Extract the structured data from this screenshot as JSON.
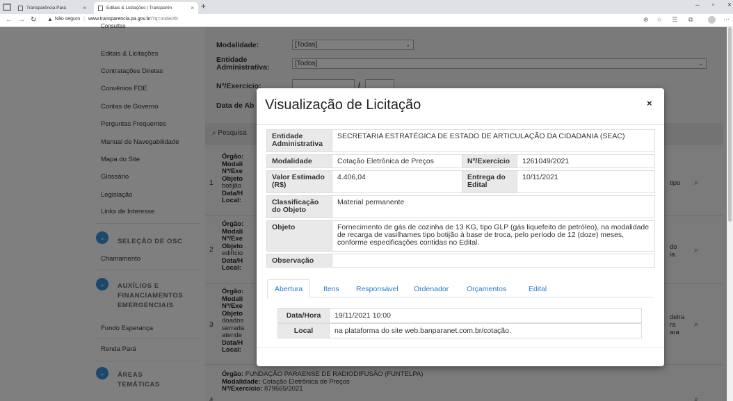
{
  "browser": {
    "tabs": [
      {
        "title": "Transparência Pará",
        "active": false
      },
      {
        "title": "Editais & Licitações | Transparên",
        "active": true
      }
    ],
    "security_label": "Não seguro",
    "url_host": "www.transparencia.pa.gov.br",
    "url_path": "/?q=node/45"
  },
  "sidebar": {
    "items_top": [
      "Consultas",
      "Editais & Licitações",
      "Contratações Diretas",
      "Convênios FDE",
      "Contas de Governo",
      "Perguntas Frequentes",
      "Manual de Navegabilidade",
      "Mapa do Site",
      "Glossário",
      "Legislação",
      "Links de Interesse"
    ],
    "section_osc": {
      "title": "SELEÇÃO DE OSC",
      "items": [
        "Chamamento"
      ]
    },
    "section_aux": {
      "title_lines": [
        "AUXÍLIOS E",
        "FINANCIAMENTOS",
        "EMERGENCIAIS"
      ],
      "items": [
        "Fundo Esperança",
        "Renda Pará"
      ]
    },
    "section_areas": {
      "title_lines": [
        "ÁREAS",
        "TEMÁTICAS"
      ]
    }
  },
  "filters": {
    "modalidade_label": "Modalidade:",
    "modalidade_value": "[Todas]",
    "entidade_label_1": "Entidade",
    "entidade_label_2": "Administrativa:",
    "entidade_value": "[Todos]",
    "exercicio_label": "Nº/Exercício:",
    "exercicio_sep": "/",
    "data_label": "Data de Ab"
  },
  "search": {
    "label": "Pesquisa"
  },
  "background_rows": [
    {
      "num": "1",
      "lines": [
        "Órgão:",
        "Modali",
        "Nº/Exe",
        "Objeto",
        "botijão",
        "Data/H",
        "Local:"
      ],
      "side": "tipo"
    },
    {
      "num": "2",
      "lines": [
        "Órgão:",
        "Modali",
        "Nº/Exe",
        "Objeto",
        "edifício",
        "Data/H",
        "Local:"
      ],
      "side": "do\nia."
    },
    {
      "num": "3",
      "lines": [
        "Órgão:",
        "Modali",
        "Nº/Exe",
        "Objeto",
        "doados",
        "serrada",
        "atende",
        "Data/H",
        "Local:"
      ],
      "side": "deira\nra\nara"
    },
    {
      "num": "4",
      "orgao_label": "Órgão:",
      "orgao_value": "FUNDAÇÃO PARAENSE DE RADIODIFUSÃO (FUNTELPA)",
      "modalidade_label": "Modalidade:",
      "modalidade_value": "Cotação Eletrônica de Preços",
      "exercicio_label": "Nº/Exercício:",
      "exercicio_value": "879665/2021"
    }
  ],
  "modal": {
    "title": "Visualização de Licitação",
    "close": "×",
    "fields": {
      "entidade_label": "Entidade Administrativa",
      "entidade_value": "SECRETARIA ESTRATÉGICA DE ESTADO DE ARTICULAÇÃO DA CIDADANIA (SEAC)",
      "modalidade_label": "Modalidade",
      "modalidade_value": "Cotação Eletrônica de Preços",
      "exercicio_label": "Nº/Exercício",
      "exercicio_value": "1261049/2021",
      "valor_label": "Valor Estimado (R$)",
      "valor_value": "4.406,04",
      "entrega_label": "Entrega do Edital",
      "entrega_value": "10/11/2021",
      "classificacao_label": "Classificação do Objeto",
      "classificacao_value": "Material permanente",
      "objeto_label": "Objeto",
      "objeto_value": "Fornecimento de gás de cozinha de 13 KG, tipo GLP (gás liquefeito de petróleo), na modalidade de recarga de vasilhames tipo botijão à base de troca, pelo período de 12 (doze) meses, conforme especificações contidas no Edital.",
      "observacao_label": "Observação",
      "observacao_value": ""
    },
    "tabs": [
      "Abertura",
      "Itens",
      "Responsável",
      "Ordenador",
      "Orçamentos",
      "Edital"
    ],
    "active_tab": "Abertura",
    "abertura": {
      "data_label": "Data/Hora",
      "data_value": "19/11/2021 10:00",
      "local_label": "Local",
      "local_value": "na plataforma do site web.banparanet.com.br/cotação."
    }
  },
  "colors": {
    "accent": "#2a7ac6",
    "section_icon": "#3a8fd6",
    "label_bg": "#e9e9e9"
  }
}
